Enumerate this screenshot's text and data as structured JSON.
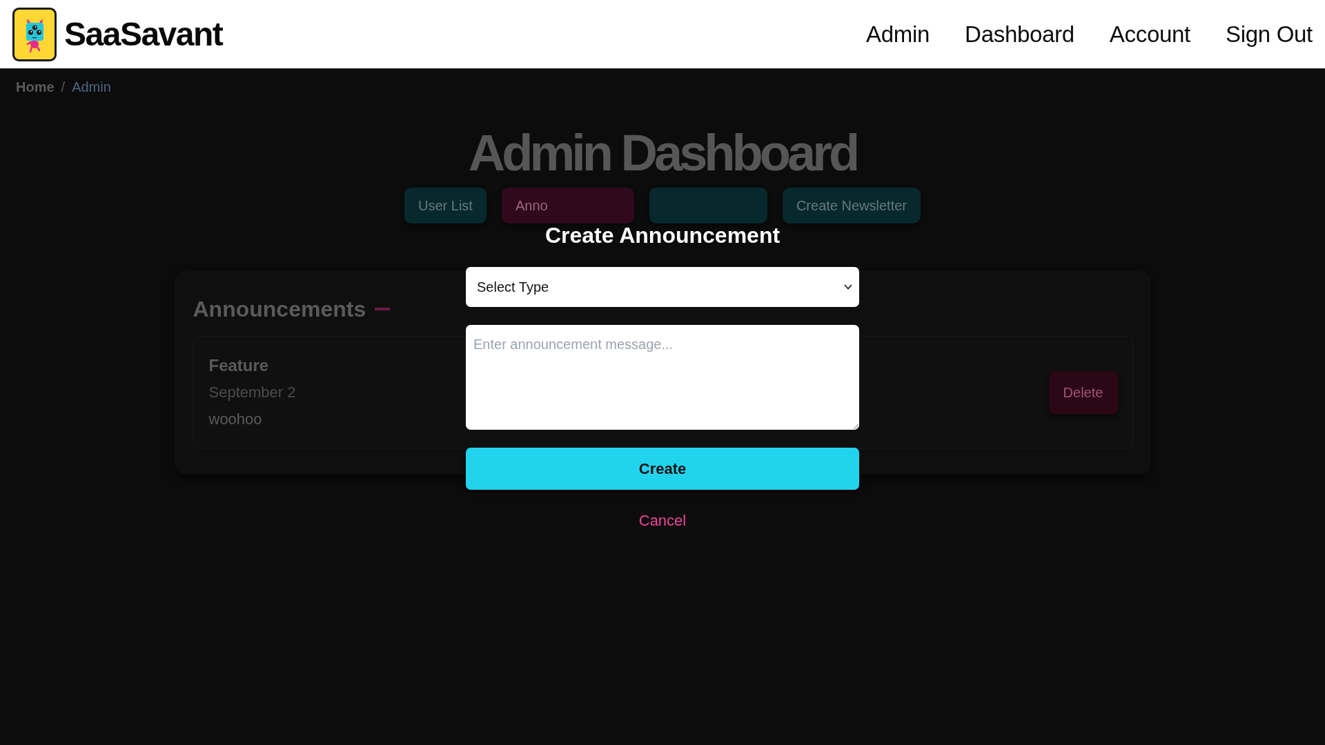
{
  "header": {
    "brand": "SaaSavant",
    "nav": [
      "Admin",
      "Dashboard",
      "Account",
      "Sign Out"
    ]
  },
  "breadcrumb": {
    "separator": "/",
    "items": [
      {
        "label": "Home",
        "current": false
      },
      {
        "label": "Admin",
        "current": true
      }
    ]
  },
  "page": {
    "title": "Admin Dashboard"
  },
  "tabs": [
    {
      "label": "User List",
      "selected": false
    },
    {
      "label": "Anno",
      "selected": true
    },
    {
      "selected": false
    },
    {
      "label": "Create Newsletter",
      "selected": false
    }
  ],
  "announcements_panel": {
    "title": "Announcements",
    "items": [
      {
        "type": "Feature",
        "date": "September 2",
        "message": "woohoo",
        "delete_label": "Delete"
      }
    ]
  },
  "modal": {
    "title": "Create Announcement",
    "type_select": {
      "value": "Select Type"
    },
    "message_field": {
      "placeholder": "Enter announcement message..."
    },
    "submit": "Create",
    "cancel": "Cancel"
  }
}
